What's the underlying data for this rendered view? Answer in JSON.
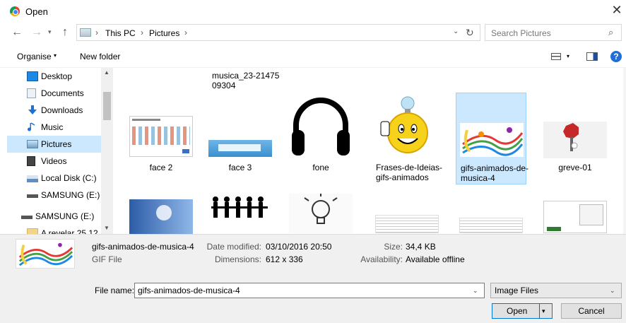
{
  "window": {
    "title": "Open",
    "close_glyph": "✕"
  },
  "nav": {
    "back_glyph": "←",
    "forward_glyph": "→",
    "recent_glyph": "▾",
    "up_glyph": "↑",
    "breadcrumb": [
      "This PC",
      "Pictures"
    ],
    "separator": "›",
    "refresh_glyph": "↻",
    "dropdown_glyph": "⌄"
  },
  "search": {
    "placeholder": "Search Pictures",
    "icon_glyph": "⌕"
  },
  "toolbar": {
    "organise_label": "Organise",
    "caret": "▾",
    "new_folder_label": "New folder",
    "help_glyph": "?"
  },
  "sidebar": {
    "items": [
      {
        "label": "Desktop",
        "icon": "desktop-icon",
        "color": "#1e88e5"
      },
      {
        "label": "Documents",
        "icon": "documents-icon",
        "color": "#9aa6b2"
      },
      {
        "label": "Downloads",
        "icon": "downloads-icon",
        "color": "#1e6fd6"
      },
      {
        "label": "Music",
        "icon": "music-icon",
        "color": "#1e6fd6"
      },
      {
        "label": "Pictures",
        "icon": "pictures-icon",
        "color": "#6fa0c8",
        "selected": true
      },
      {
        "label": "Videos",
        "icon": "videos-icon",
        "color": "#444444"
      },
      {
        "label": "Local Disk (C:)",
        "icon": "drive-icon",
        "color": "#5b8fc9"
      },
      {
        "label": "SAMSUNG (E:)",
        "icon": "usb-drive-icon",
        "color": "#555555"
      },
      {
        "label": "SAMSUNG (E:)",
        "icon": "usb-drive-icon",
        "color": "#555555"
      },
      {
        "label": "A revelar 25.12",
        "icon": "folder-icon",
        "color": "#e8c060"
      }
    ],
    "scroll_up": "▲",
    "scroll_down": "▼"
  },
  "files": {
    "row1": [
      {
        "name": "face 2",
        "thumb": "screenshot-thumb"
      },
      {
        "name": "face 3",
        "thumb": "screenshot-thumb"
      },
      {
        "name": "fone",
        "thumb": "headphones-image"
      },
      {
        "name": "Frases-de-Ideias-gifs-animados",
        "thumb": "lightbulb-smiley-image"
      },
      {
        "name": "gifs-animados-de-musica-4",
        "thumb": "music-notes-image",
        "selected": true
      },
      {
        "name": "greve-01",
        "thumb": "stop-sign-image"
      }
    ],
    "top_label": "musica_23-2147509304",
    "row2": [
      "facebook-banner-thumb",
      "silhouettes-image",
      "lightbulb-sketch-image",
      "document-thumb",
      "document-thumb",
      "screenshot-thumb"
    ]
  },
  "details": {
    "name": "gifs-animados-de-musica-4",
    "type": "GIF File",
    "date_modified_label": "Date modified:",
    "date_modified": "03/10/2016 20:50",
    "dimensions_label": "Dimensions:",
    "dimensions": "612 x 336",
    "size_label": "Size:",
    "size": "34,4 KB",
    "availability_label": "Availability:",
    "availability": "Available offline"
  },
  "bottom": {
    "filename_label": "File name:",
    "filename": "gifs-animados-de-musica-4",
    "filetype": "Image Files",
    "caret": "⌄",
    "open_label": "Open",
    "open_arrow": "▾",
    "cancel_label": "Cancel"
  },
  "colors": {
    "selection": "#cce8ff",
    "accent": "#0078d7",
    "panel": "#f0f0f0"
  }
}
